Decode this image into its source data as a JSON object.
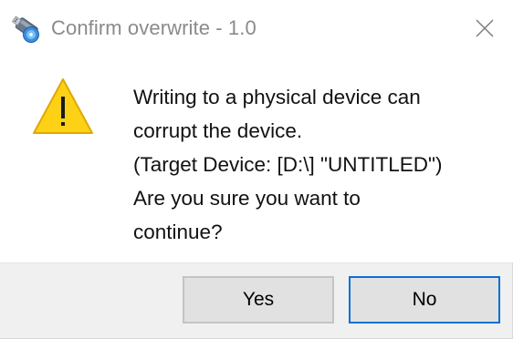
{
  "window": {
    "title": "Confirm overwrite - 1.0",
    "app_icon": "usb-drive-icon",
    "close_icon": "close-icon"
  },
  "dialog": {
    "icon": "warning-icon",
    "message_lines": [
      "Writing to a physical device can",
      "corrupt the device.",
      "(Target Device: [D:\\] \"UNTITLED\")",
      "Are you sure you want to",
      "continue?"
    ]
  },
  "buttons": {
    "yes_label": "Yes",
    "no_label": "No"
  },
  "colors": {
    "warning_fill": "#fcd116",
    "focus_border": "#0a6fd4",
    "footer_background": "#f0f0f0",
    "title_text": "#8a8a8a"
  }
}
